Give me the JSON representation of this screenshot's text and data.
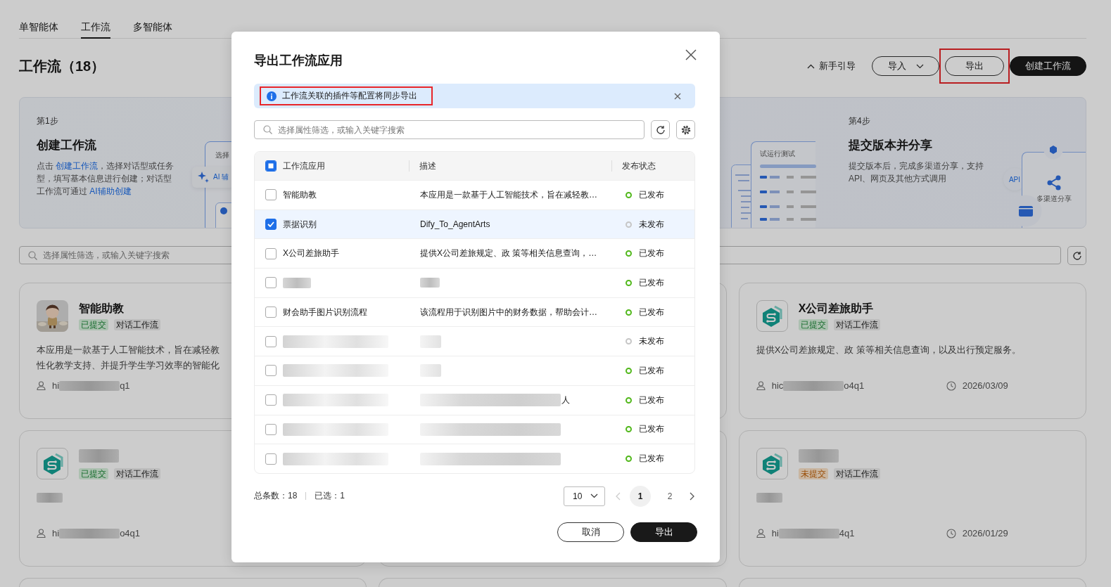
{
  "tabs": [
    {
      "label": "单智能体",
      "selected": false
    },
    {
      "label": "工作流",
      "selected": true
    },
    {
      "label": "多智能体",
      "selected": false
    }
  ],
  "heading": "工作流（18）",
  "toolbar": [
    {
      "kind": "guide",
      "label": "新手引导",
      "highlighted": false
    },
    {
      "kind": "dropdown",
      "label": "导入",
      "highlighted": false
    },
    {
      "kind": "outline",
      "label": "导出",
      "highlighted": true
    },
    {
      "kind": "primary",
      "label": "创建工作流",
      "highlighted": false
    }
  ],
  "steps": [
    {
      "kind": "select",
      "label": "第1步",
      "title": "创建工作流",
      "parts": [
        {
          "text": "点击 "
        },
        {
          "text": "创建工作流",
          "link": true
        },
        {
          "text": "，选择对话型或任务型，填写基本信息进行创建；对话型工作流可通过 "
        },
        {
          "text": "AI辅助创建",
          "link": true
        }
      ],
      "art_texts": [
        "选择",
        "AI 辅"
      ]
    },
    {
      "kind": "test",
      "art_texts": [
        "试运行测试"
      ]
    },
    {
      "kind": "share",
      "label": "第4步",
      "title": "提交版本并分享",
      "parts": [
        {
          "text": "提交版本后，完成多渠道分享，支持API、网页及其他方式调用"
        }
      ],
      "art_texts": [
        "API",
        "多渠道分享"
      ]
    }
  ],
  "search": {
    "placeholder": "选择属性筛选，或输入关键字搜索"
  },
  "cards": [
    {
      "kind": "app",
      "avatar": {
        "kind": "picture"
      },
      "title": "智能助教",
      "tags": [
        {
          "label": "已提交",
          "kind": "submitted"
        },
        {
          "label": "对话工作流",
          "kind": "type"
        }
      ],
      "desc_lines": [
        "本应用是一款基于人工智能技术，旨在减轻教",
        "性化教学支持、并提升学生学习效率的智能化"
      ],
      "owner_prefix": "hi",
      "owner_suffix": "q1"
    },
    {
      "kind": "blank"
    },
    {
      "kind": "app",
      "avatar": {
        "kind": "logo"
      },
      "title": "X公司差旅助手",
      "tags": [
        {
          "label": "已提交",
          "kind": "submitted"
        },
        {
          "label": "对话工作流",
          "kind": "type"
        }
      ],
      "desc_lines": [
        "提供X公司差旅规定、政 策等相关信息查询，以及出行预定服务。"
      ],
      "owner_prefix": "hic",
      "owner_suffix": "o4q1",
      "date": "2026/03/09"
    },
    {
      "kind": "app",
      "avatar": {
        "kind": "logo"
      },
      "title_redacted": true,
      "tags": [
        {
          "label": "已提交",
          "kind": "submitted"
        },
        {
          "label": "对话工作流",
          "kind": "type"
        }
      ],
      "desc_redacted": true,
      "owner_prefix": "hi",
      "owner_suffix": "o4q1"
    },
    {
      "kind": "blank"
    },
    {
      "kind": "app",
      "avatar": {
        "kind": "logo"
      },
      "title_redacted": true,
      "tags": [
        {
          "label": "未提交",
          "kind": "draft"
        },
        {
          "label": "对话工作流",
          "kind": "type"
        }
      ],
      "desc_redacted": true,
      "owner_prefix": "hi",
      "owner_suffix": "4q1",
      "date": "2026/01/29"
    },
    {
      "kind": "blank"
    },
    {
      "kind": "blank"
    },
    {
      "kind": "blank"
    }
  ],
  "dialog": {
    "title": "导出工作流应用",
    "notice": {
      "text": "工作流关联的插件等配置将同步导出",
      "highlighted": true
    },
    "search": {
      "placeholder": "选择属性筛选，或输入关键字搜索"
    },
    "columns": [
      "工作流应用",
      "描述",
      "发布状态"
    ],
    "select_all": {
      "indeterminate": true
    },
    "rows": [
      {
        "kind": "text",
        "name": "智能助教",
        "desc": "本应用是一款基于人工智能技术，旨在减轻教…",
        "status": "已发布",
        "published": true,
        "checked": false
      },
      {
        "kind": "text",
        "name": "票据识别",
        "desc": "Dify_To_AgentArts",
        "status": "未发布",
        "published": false,
        "checked": true
      },
      {
        "kind": "text",
        "name": "X公司差旅助手",
        "desc": "提供X公司差旅规定、政 策等相关信息查询，…",
        "status": "已发布",
        "published": true,
        "checked": false
      },
      {
        "kind": "short",
        "status": "已发布",
        "published": true,
        "checked": false
      },
      {
        "kind": "text",
        "name": "财会助手图片识别流程",
        "desc": "该流程用于识别图片中的财务数据，帮助会计…",
        "status": "已发布",
        "published": true,
        "checked": false
      },
      {
        "kind": "long",
        "status": "未发布",
        "published": false,
        "checked": false
      },
      {
        "kind": "long",
        "status": "已发布",
        "published": true,
        "checked": false
      },
      {
        "kind": "wide",
        "desc_tail": "人",
        "status": "已发布",
        "published": true,
        "checked": false
      },
      {
        "kind": "wide",
        "status": "已发布",
        "published": true,
        "checked": false
      },
      {
        "kind": "wide",
        "status": "已发布",
        "published": true,
        "checked": false
      }
    ],
    "total": "总条数：18",
    "selected_count": "已选：1",
    "page_size": "10",
    "pages": [
      {
        "label": "1",
        "selected": true
      },
      {
        "label": "2",
        "selected": false
      }
    ],
    "cancel": "取消",
    "confirm": "导出"
  }
}
